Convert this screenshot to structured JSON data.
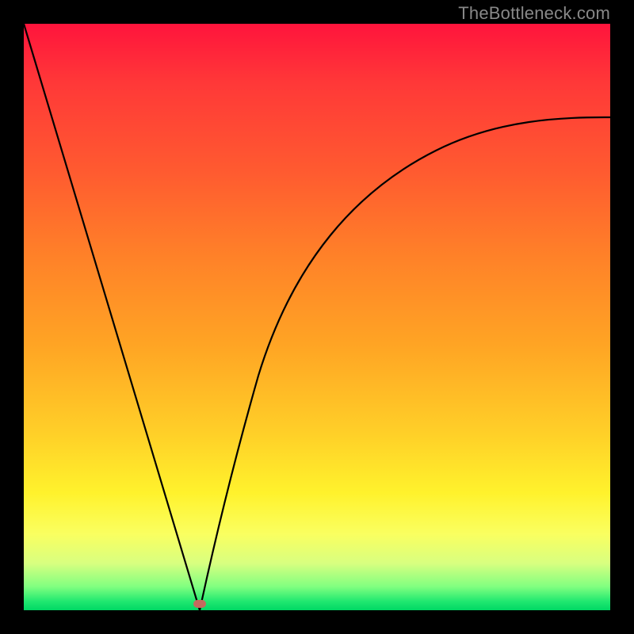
{
  "watermark": "TheBottleneck.com",
  "colors": {
    "frame": "#000000",
    "gradient_top": "#ff143c",
    "gradient_bottom": "#00d864",
    "curve": "#000000",
    "marker": "#c46a5e"
  },
  "chart_data": {
    "type": "line",
    "title": "",
    "xlabel": "",
    "ylabel": "",
    "xlim": [
      0,
      100
    ],
    "ylim": [
      0,
      100
    ],
    "annotations": [
      "TheBottleneck.com"
    ],
    "series": [
      {
        "name": "left-branch",
        "x": [
          0,
          5,
          10,
          15,
          20,
          25,
          28,
          30
        ],
        "y": [
          100,
          83,
          67,
          50,
          33,
          17,
          7,
          0
        ]
      },
      {
        "name": "right-branch",
        "x": [
          30,
          32,
          35,
          40,
          45,
          50,
          55,
          60,
          65,
          70,
          75,
          80,
          85,
          90,
          95,
          100
        ],
        "y": [
          0,
          10,
          23,
          40,
          51,
          59,
          65,
          70,
          73,
          76,
          78,
          80,
          81.5,
          82.5,
          83.5,
          84
        ]
      }
    ],
    "marker": {
      "x": 30,
      "y": 0.5,
      "shape": "rounded-rect"
    }
  }
}
